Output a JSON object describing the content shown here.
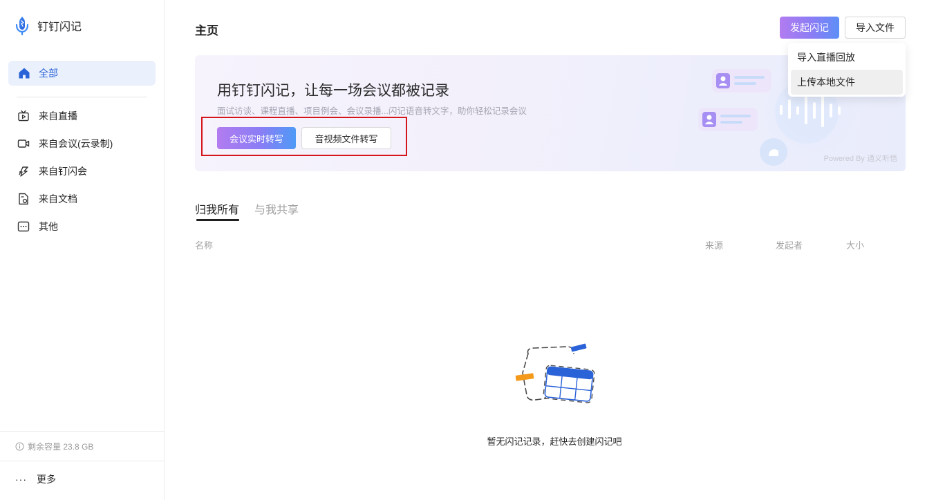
{
  "app": {
    "name": "钉钉闪记"
  },
  "sidebar": {
    "all_label": "全部",
    "items": [
      {
        "label": "来自直播",
        "icon": "tv-icon"
      },
      {
        "label": "来自会议(云录制)",
        "icon": "video-camera-icon"
      },
      {
        "label": "来自钉闪会",
        "icon": "lightning-icon"
      },
      {
        "label": "来自文档",
        "icon": "document-icon"
      },
      {
        "label": "其他",
        "icon": "more-box-icon"
      }
    ],
    "capacity": "剩余容量 23.8 GB",
    "more_label": "更多",
    "more_dots": "···"
  },
  "header": {
    "title": "主页",
    "primary_button": "发起闪记",
    "import_button": "导入文件"
  },
  "dropdown": {
    "items": [
      "导入直播回放",
      "上传本地文件"
    ]
  },
  "banner": {
    "title": "用钉钉闪记，让每一场会议都被记录",
    "subtitle": "面试访谈、课程直播、项目例会、会议录播...闪记语音转文字，助你轻松记录会议",
    "live_button": "会议实时转写",
    "file_button": "音视频文件转写",
    "powered": "Powered By 通义听悟"
  },
  "tabs": {
    "mine": "归我所有",
    "shared": "与我共享"
  },
  "table": {
    "columns": [
      "名称",
      "来源",
      "发起者",
      "大小"
    ]
  },
  "empty": {
    "text": "暂无闪记记录，赶快去创建闪记吧"
  },
  "colors": {
    "accent": "#2a62d8",
    "gradient_start": "#b27cf0",
    "gradient_end": "#5d8ff7",
    "highlight": "#d6141c"
  }
}
